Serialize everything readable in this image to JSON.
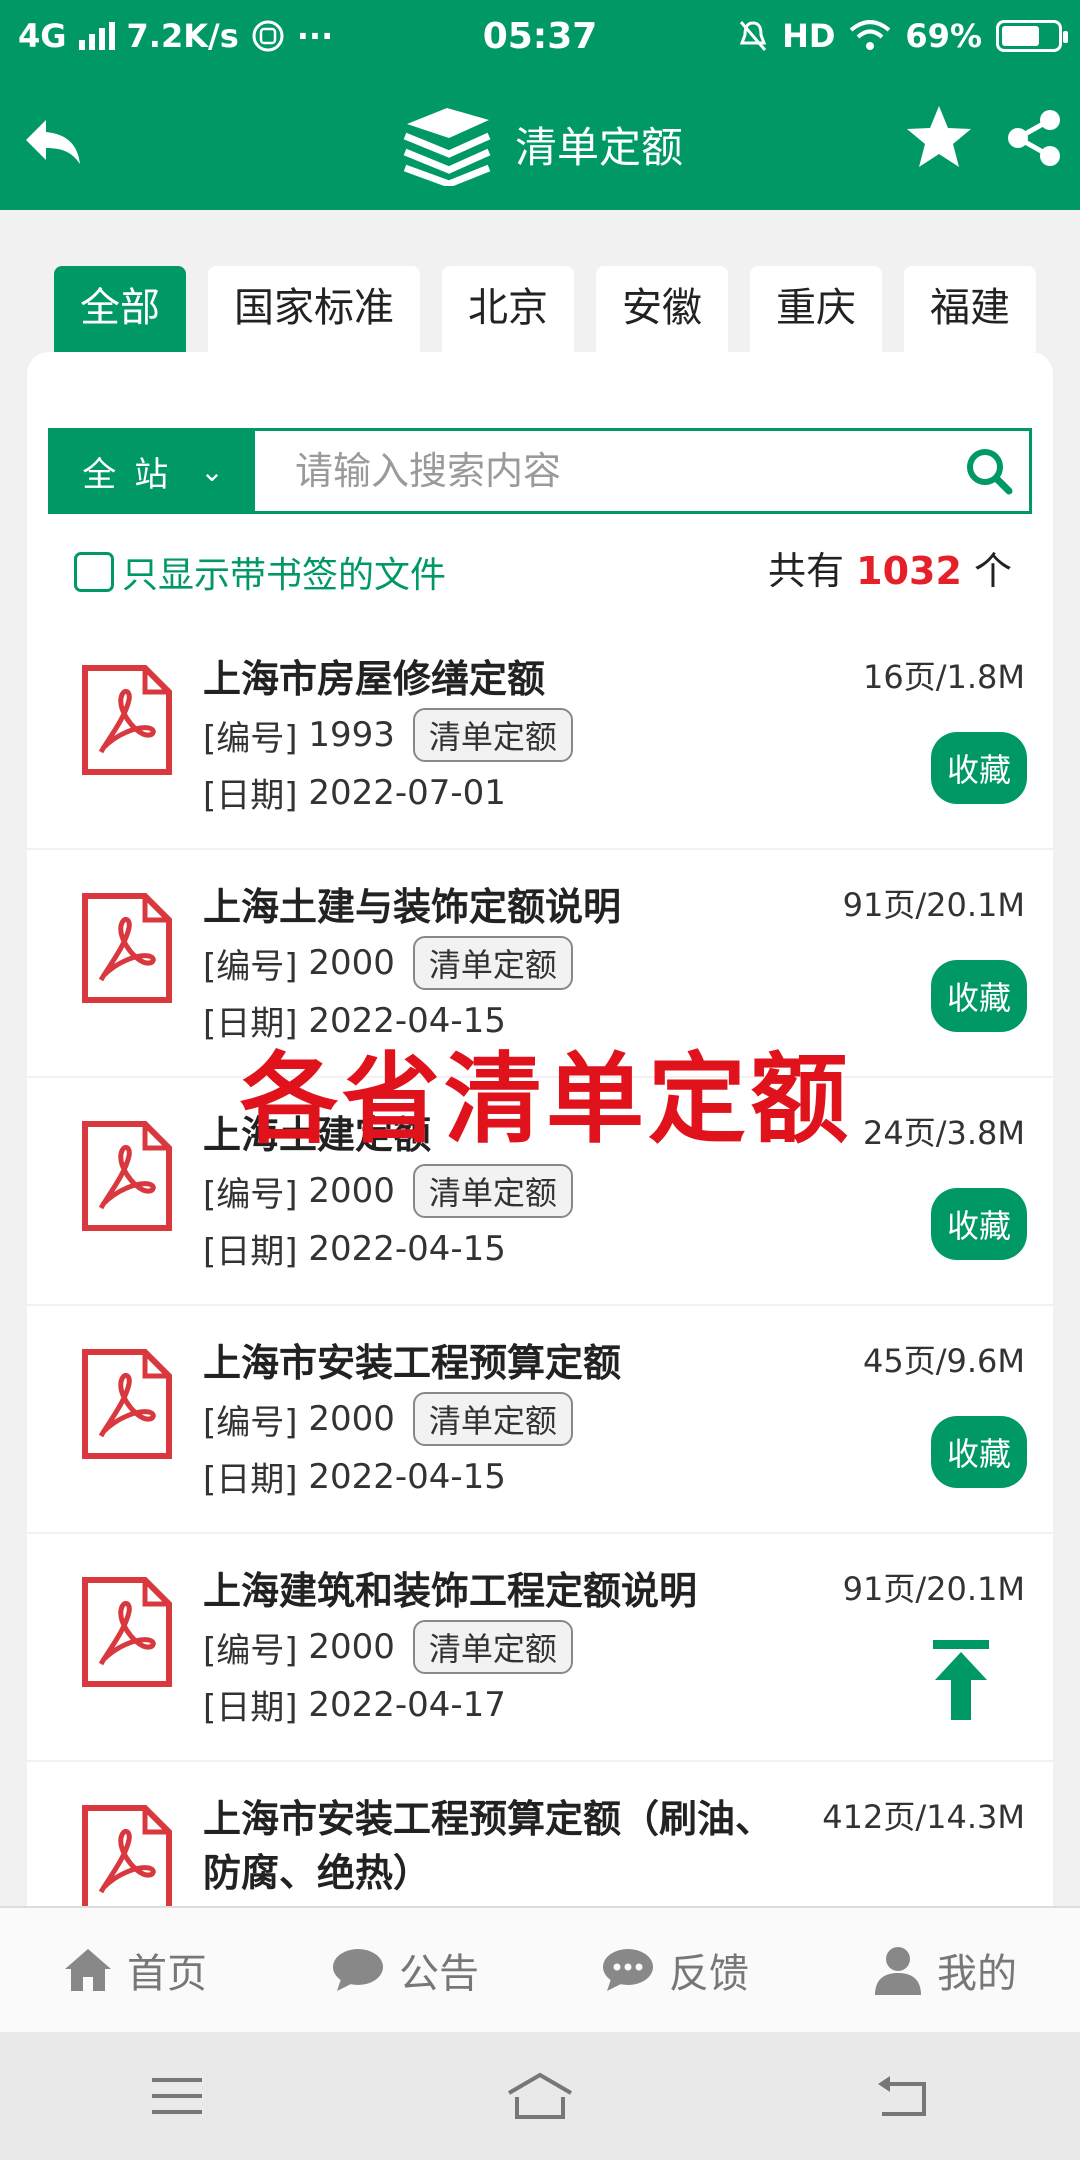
{
  "status": {
    "network": "4G",
    "speed": "7.2K/s",
    "more": "···",
    "time": "05:37",
    "hd": "HD",
    "battery": "69%",
    "battery_level": 0.69
  },
  "header": {
    "title": "清单定额"
  },
  "tabs": [
    "全部",
    "国家标准",
    "北京",
    "安徽",
    "重庆",
    "福建"
  ],
  "search": {
    "scope_label": "全站",
    "placeholder": "请输入搜索内容"
  },
  "filter": {
    "label": "只显示带书签的文件"
  },
  "count": {
    "prefix": "共有",
    "value": "1032",
    "suffix": "个"
  },
  "list": {
    "no_prefix": "[编号]",
    "date_prefix": "[日期]",
    "fav_label": "收藏",
    "items": [
      {
        "title": "上海市房屋修缮定额",
        "number": "1993",
        "tag": "清单定额",
        "date": "2022-07-01",
        "size": "16页/1.8M"
      },
      {
        "title": "上海土建与装饰定额说明",
        "number": "2000",
        "tag": "清单定额",
        "date": "2022-04-15",
        "size": "91页/20.1M"
      },
      {
        "title": "上海土建定额",
        "number": "2000",
        "tag": "清单定额",
        "date": "2022-04-15",
        "size": "24页/3.8M"
      },
      {
        "title": "上海市安装工程预算定额",
        "number": "2000",
        "tag": "清单定额",
        "date": "2022-04-15",
        "size": "45页/9.6M"
      },
      {
        "title": "上海建筑和装饰工程定额说明",
        "number": "2000",
        "tag": "清单定额",
        "date": "2022-04-17",
        "size": "91页/20.1M"
      },
      {
        "title": "上海市安装工程预算定额（刷油、防腐、绝热）",
        "size": "412页/14.3M"
      }
    ]
  },
  "overlay_text": "各省清单定额",
  "bottom_nav": {
    "home": "首页",
    "notice": "公告",
    "feedback": "反馈",
    "mine": "我的"
  },
  "colors": {
    "primary": "#009966",
    "accent_red": "#e6202a",
    "pdf_red": "#d9383e"
  }
}
